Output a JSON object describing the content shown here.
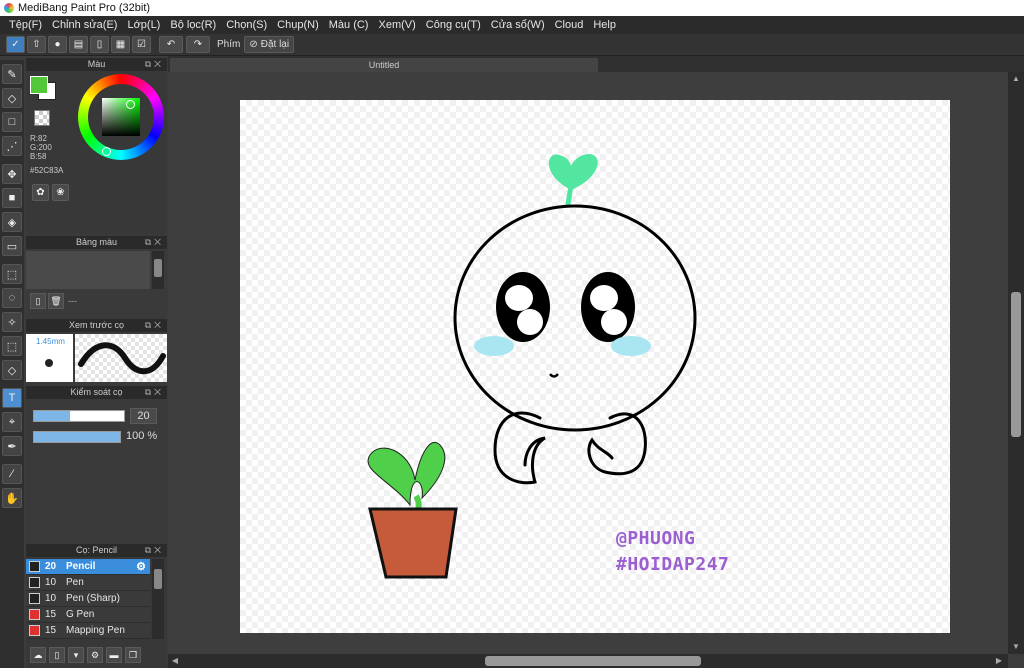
{
  "window": {
    "title": "MediBang Paint Pro (32bit)"
  },
  "menu": [
    "Tệp(F)",
    "Chỉnh sửa(E)",
    "Lớp(L)",
    "Bộ lọc(R)",
    "Chọn(S)",
    "Chụp(N)",
    "Màu (C)",
    "Xem(V)",
    "Công cụ(T)",
    "Cửa sổ(W)",
    "Cloud",
    "Help"
  ],
  "toolbar": {
    "key_label": "Phím",
    "reset_label": "Đặt lại"
  },
  "panels": {
    "color": {
      "title": "Màu",
      "fg_color": "#52C83A",
      "r": "R:82",
      "g": "G:200",
      "b": "B:58",
      "hex": "#52C83A"
    },
    "palette": {
      "title": "Bảng màu",
      "dash": "---"
    },
    "brush_preview": {
      "title": "Xem trước cọ",
      "size": "1.45mm"
    },
    "brush_control": {
      "title": "Kiểm soát cọ",
      "size_value": "20",
      "size_fraction": 0.4,
      "opacity_value": "100 %",
      "opacity_fraction": 1.0
    },
    "brush": {
      "title": "Cọ: Pencil",
      "items": [
        {
          "size": "20",
          "name": "Pencil",
          "color": "#222222",
          "selected": true
        },
        {
          "size": "10",
          "name": "Pen",
          "color": "#222222",
          "selected": false
        },
        {
          "size": "10",
          "name": "Pen (Sharp)",
          "color": "#222222",
          "selected": false
        },
        {
          "size": "15",
          "name": "G Pen",
          "color": "#e03030",
          "selected": false
        },
        {
          "size": "15",
          "name": "Mapping Pen",
          "color": "#e03030",
          "selected": false
        }
      ]
    }
  },
  "document": {
    "tab_title": "Untitled"
  },
  "canvas": {
    "watermark_line1": "@PHUONG",
    "watermark_line2": "#HOIDAP247"
  }
}
